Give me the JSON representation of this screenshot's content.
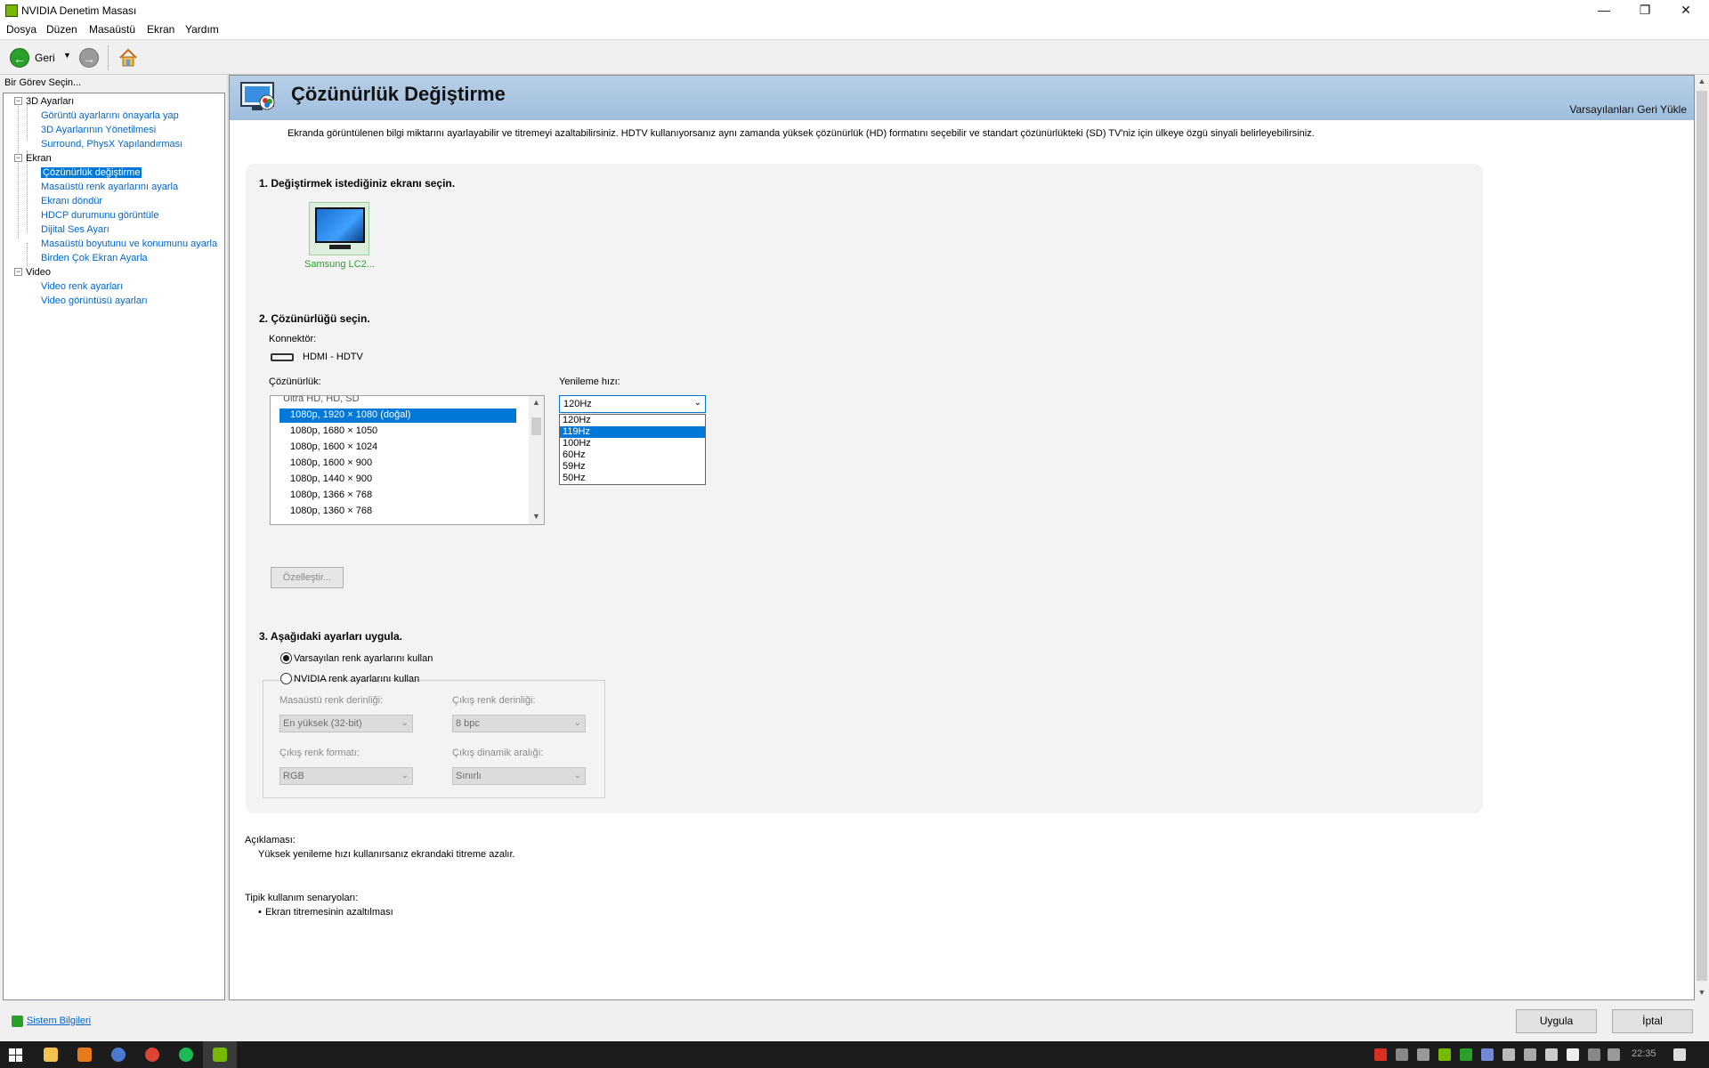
{
  "window": {
    "title": "NVIDIA Denetim Masası",
    "controls": {
      "minimize": "—",
      "restore": "❐",
      "close": "✕"
    }
  },
  "menu": [
    "Dosya",
    "Düzen",
    "Masaüstü",
    "Ekran",
    "Yardım"
  ],
  "toolbar": {
    "back_label": "Geri",
    "back_glyph": "←",
    "forward_glyph": "→",
    "dropdown_glyph": "▼"
  },
  "left_panel": {
    "header": "Bir Görev Seçin...",
    "tree": [
      {
        "category": "3D Ayarları",
        "expander": "−",
        "items": [
          "Görüntü ayarlarını önayarla yap",
          "3D Ayarlarının Yönetilmesi",
          "Surround, PhysX Yapılandırması"
        ]
      },
      {
        "category": "Ekran",
        "expander": "−",
        "items": [
          "Çözünürlük değiştirme",
          "Masaüstü renk ayarlarını ayarla",
          "Ekranı döndür",
          "HDCP durumunu görüntüle",
          "Dijital Ses Ayarı",
          "Masaüstü boyutunu ve konumunu ayarla",
          "Birden Çok Ekran Ayarla"
        ]
      },
      {
        "category": "Video",
        "expander": "−",
        "items": [
          "Video renk ayarları",
          "Video görüntüsü ayarları"
        ]
      }
    ],
    "selected": "Çözünürlük değiştirme"
  },
  "content": {
    "title": "Çözünürlük Değiştirme",
    "restore_defaults": "Varsayılanları Geri Yükle",
    "description": "Ekranda görüntülenen bilgi miktarını ayarlayabilir ve titremeyi azaltabilirsiniz. HDTV kullanıyorsanız aynı zamanda yüksek çözünürlük (HD) formatını seçebilir ve standart çözünürlükteki (SD) TV'niz için ülkeye özgü sinyali belirleyebilirsiniz.",
    "step1": {
      "title": "1. Değiştirmek istediğiniz ekranı seçin.",
      "display_label": "Samsung LC2..."
    },
    "step2": {
      "title": "2. Çözünürlüğü seçin.",
      "connector_label": "Konnektör:",
      "connector_value": "HDMI - HDTV",
      "resolution_label": "Çözünürlük:",
      "resolution_group": "Ultra HD, HD, SD",
      "resolutions": [
        "1080p, 1920 × 1080 (doğal)",
        "1080p, 1680 × 1050",
        "1080p, 1600 × 1024",
        "1080p, 1600 × 900",
        "1080p, 1440 × 900",
        "1080p, 1366 × 768",
        "1080p, 1360 × 768"
      ],
      "selected_resolution": "1080p, 1920 × 1080 (doğal)",
      "refresh_label": "Yenileme hızı:",
      "refresh_value": "120Hz",
      "refresh_options": [
        "120Hz",
        "119Hz",
        "100Hz",
        "60Hz",
        "59Hz",
        "50Hz"
      ],
      "refresh_highlighted": "119Hz",
      "customize_button": "Özelleştir..."
    },
    "step3": {
      "title": "3. Aşağıdaki ayarları uygula.",
      "radio_default": "Varsayılan renk ayarlarını kullan",
      "radio_nvidia": "NVIDIA renk ayarlarını kullan",
      "selected_radio": "default",
      "desktop_color_depth_label": "Masaüstü renk derinliği:",
      "desktop_color_depth_value": "En yüksek (32-bit)",
      "output_color_depth_label": "Çıkış renk derinliği:",
      "output_color_depth_value": "8 bpc",
      "output_color_format_label": "Çıkış renk formatı:",
      "output_color_format_value": "RGB",
      "output_dynamic_range_label": "Çıkış dinamik aralığı:",
      "output_dynamic_range_value": "Sınırlı"
    },
    "explanation_label": "Açıklaması:",
    "explanation_text": "Yüksek yenileme hızı kullanırsanız ekrandaki titreme azalır.",
    "scenarios_label": "Tipik kullanım senaryoları:",
    "scenarios": [
      "Ekran titremesinin azaltılması"
    ]
  },
  "bottom": {
    "system_info": "Sistem Bilgileri",
    "apply": "Uygula",
    "cancel": "İptal"
  },
  "taskbar": {
    "clock": "22:35"
  },
  "colors": {
    "nvidia_green": "#76b900",
    "selection_blue": "#0078d7",
    "link_blue": "#0066cc",
    "banner": "#b8cfe6",
    "taskbar": "#1c1c1c"
  }
}
